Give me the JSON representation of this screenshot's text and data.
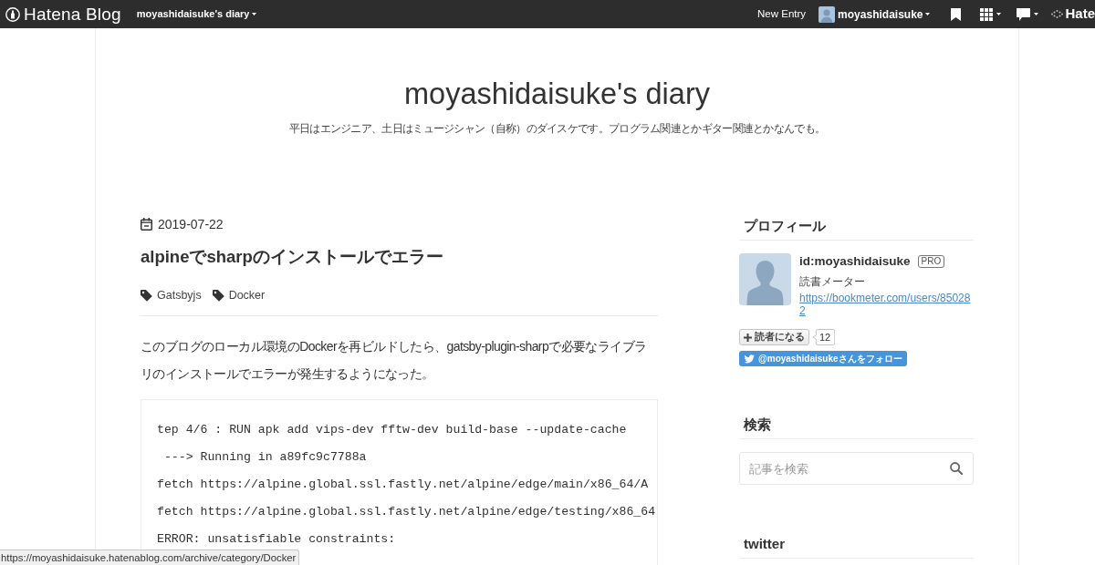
{
  "top_bar": {
    "logo": "Hatena Blog",
    "blog_menu": "moyashidaisuke's diary",
    "new_entry": "New Entry",
    "user_menu": "moyashidaisuke",
    "brand": "Hate"
  },
  "header": {
    "title": "moyashidaisuke's diary",
    "description": "平日はエンジニア、土日はミュージシャン（自称）のダイスケです。プログラム関連とかギター関連とかなんでも。"
  },
  "entry": {
    "date": "2019-07-22",
    "title": "alpineでsharpのインストールでエラー",
    "tags": [
      "Gatsbyjs",
      "Docker"
    ],
    "paragraph": "このブログのローカル環境のDockerを再ビルドしたら、gatsby-plugin-sharpで必要なライブラリのインストールでエラーが発生するようになった。",
    "code_lines": [
      "tep 4/6 : RUN apk add vips-dev fftw-dev build-base --update-cache",
      " ---> Running in a89fc9c7788a",
      "fetch https://alpine.global.ssl.fastly.net/alpine/edge/main/x86_64/A",
      "fetch https://alpine.global.ssl.fastly.net/alpine/edge/testing/x86_64",
      "ERROR: unsatisfiable constraints:"
    ]
  },
  "sidebar": {
    "profile": {
      "heading": "プロフィール",
      "user_id": "id:moyashidaisuke",
      "badge": "PRO",
      "bio": "読書メーター",
      "link": "https://bookmeter.com/users/850282",
      "subscribe_button": "読者になる",
      "subscriber_count": "12",
      "follow_button": "@moyashidaisukeさんをフォロー"
    },
    "search": {
      "heading": "検索",
      "placeholder": "記事を検索"
    },
    "twitter": {
      "heading": "twitter"
    }
  },
  "status_bar": {
    "url": "https://moyashidaisuke.hatenablog.com/archive/category/Docker"
  }
}
